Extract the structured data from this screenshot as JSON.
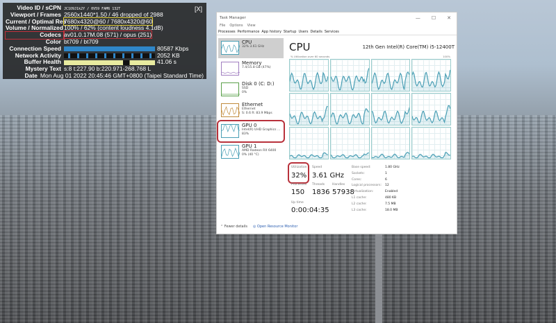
{
  "stats": {
    "close": "[X]",
    "rows": [
      {
        "label": "Video ID / sCPN",
        "value": "JC1O9J1k2Y / 0V59 FAM6 132T"
      },
      {
        "label": "Viewport / Frames",
        "value": "2560x1440*1.50 / 46 dropped of 2988"
      },
      {
        "label": "Current / Optimal Res",
        "value": "7680x4320@60 / 7680x4320@60"
      },
      {
        "label": "Volume / Normalized",
        "value": "100% / 62% (content loudness 4.1dB)"
      },
      {
        "label": "Codecs",
        "value": "av01.0.17M.08 (571) / opus (251)"
      },
      {
        "label": "Color",
        "value": "bt709 / bt709"
      },
      {
        "label": "Connection Speed",
        "value": "80587 Kbps"
      },
      {
        "label": "Network Activity",
        "value": "2052 KB"
      },
      {
        "label": "Buffer Health",
        "value": "41.06 s"
      },
      {
        "label": "Mystery Text",
        "value": "s:8 t:227.90 b:220.971-268.768 L"
      },
      {
        "label": "Date",
        "value": "Mon Aug 01 2022 20:45:46 GMT+0800 (Taipei Standard Time)"
      }
    ]
  },
  "taskmanager": {
    "title": "Task Manager",
    "menu": [
      "File",
      "Options",
      "View"
    ],
    "tabs": [
      "Processes",
      "Performance",
      "App history",
      "Startup",
      "Users",
      "Details",
      "Services"
    ],
    "sidebar": [
      {
        "name": "CPU",
        "sub1": "32% 3.61 GHz",
        "sub2": ""
      },
      {
        "name": "Memory",
        "sub1": "7.4/15.8 GB (47%)",
        "sub2": ""
      },
      {
        "name": "Disk 0 (C: D:)",
        "sub1": "SSD",
        "sub2": "0%"
      },
      {
        "name": "Ethernet",
        "sub1": "Ethernet",
        "sub2": "S: 0.6 R: 83.9 Mbps"
      },
      {
        "name": "GPU 0",
        "sub1": "Intel(R) UHD Graphics ...",
        "sub2": "83%"
      },
      {
        "name": "GPU 1",
        "sub1": "AMD Radeon RX 6400",
        "sub2": "0% (40 °C)"
      }
    ],
    "main": {
      "title": "CPU",
      "model": "12th Gen Intel(R) Core(TM) i5-12400T",
      "caption": "% Utilization over 60 seconds",
      "max": "100%",
      "utilization_label": "Utilization",
      "utilization": "32%",
      "speed_label": "Speed",
      "speed": "3.61 GHz",
      "processes_label": "Processes",
      "processes": "150",
      "threads_label": "Threads",
      "threads": "1836",
      "handles_label": "Handles",
      "handles": "57938",
      "uptime_label": "Up time",
      "uptime": "0:00:04:35",
      "specs": [
        {
          "k": "Base speed:",
          "v": "1.80 GHz"
        },
        {
          "k": "Sockets:",
          "v": "1"
        },
        {
          "k": "Cores:",
          "v": "6"
        },
        {
          "k": "Logical processors:",
          "v": "12"
        },
        {
          "k": "Virtualization:",
          "v": "Enabled"
        },
        {
          "k": "L1 cache:",
          "v": "480 KB"
        },
        {
          "k": "L2 cache:",
          "v": "7.5 MB"
        },
        {
          "k": "L3 cache:",
          "v": "18.0 MB"
        }
      ]
    },
    "footer": {
      "fewer": "Fewer details",
      "monitor": "Open Resource Monitor"
    }
  },
  "colors": {
    "graph": "#4a9fb5",
    "highlight_red": "#b8313b",
    "highlight_yellow": "#e6d33a"
  }
}
